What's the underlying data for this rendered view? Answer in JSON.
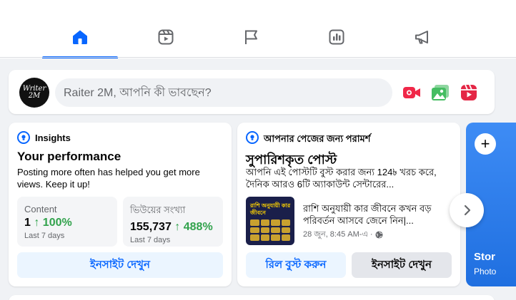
{
  "tabs": [
    {
      "name": "home",
      "icon": "home-icon",
      "active": true
    },
    {
      "name": "reels",
      "icon": "reels-icon",
      "active": false
    },
    {
      "name": "page",
      "icon": "flag-icon",
      "active": false
    },
    {
      "name": "insights",
      "icon": "bar-chart-icon",
      "active": false
    },
    {
      "name": "ads",
      "icon": "megaphone-icon",
      "active": false
    }
  ],
  "composer": {
    "avatar_text": "Writer 2M",
    "placeholder": "Raiter 2M, আপনি কী ভাবছেন?",
    "actions": [
      {
        "icon": "live-video-icon",
        "color": "#f02849"
      },
      {
        "icon": "photo-icon",
        "color": "#45bd62"
      },
      {
        "icon": "reel-icon",
        "color": "#e42645"
      }
    ]
  },
  "insights_card": {
    "kicker": "Insights",
    "title": "Your performance",
    "description": "Posting more often has helped you get more views. Keep it up!",
    "stats": [
      {
        "label": "Content",
        "value": "1",
        "change": "↑ 100%",
        "period": "Last 7 days"
      },
      {
        "label": "ভিউয়ের সংখ্যা",
        "value": "155,737",
        "change": "↑ 488%",
        "period": "Last 7 days"
      }
    ],
    "button": "ইনসাইট দেখুন"
  },
  "reco_card": {
    "kicker": "আপনার পেজের জন্য পরামর্শ",
    "title": "সুপারিশকৃত পোস্ট",
    "description": "আপনি এই পোস্টটি বুস্ট করার জন্য 124৳ খরচ করে, দৈনিক আরও 6টি অ্যাকাউন্ট সেন্টারের...",
    "thumb_text": "রাশি অনুযায়ী কার জীবনে",
    "post_text": "রাশি অনুযায়ী কার জীবনে কখন বড় পরিবর্তন আসবে জেনে নিন|...",
    "post_meta": "28 জুন, 8:45 AM-এ ·",
    "boost_button": "রিল বুস্ট করুন",
    "insights_button": "ইনসাইট দেখুন"
  },
  "stories_card": {
    "title": "Stor",
    "subtitle": "Photo"
  },
  "colors": {
    "accent": "#0866ff",
    "positive": "#31a24c"
  }
}
